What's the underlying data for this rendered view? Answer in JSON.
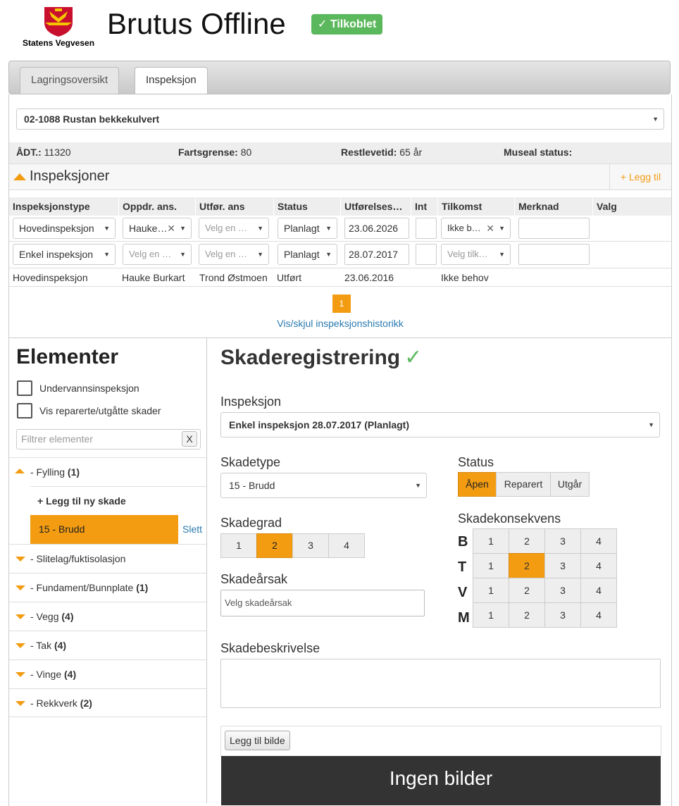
{
  "brand": {
    "logo_text": "Statens Vegvesen",
    "title": "Brutus Offline",
    "status_badge": "✓ Tilkoblet",
    "accent": "#f39c12",
    "success": "#5cb85c"
  },
  "tabs": [
    {
      "label": "Lagringsoversikt"
    },
    {
      "label": "Inspeksjon"
    }
  ],
  "structure_select": "02-1088 Rustan bekkekulvert",
  "info": {
    "adt_label": "ÅDT.:",
    "adt_value": "11320",
    "fart_label": "Fartsgrense:",
    "fart_value": "80",
    "rest_label": "Restlevetid:",
    "rest_value": "65 år",
    "museal_label": "Museal status:"
  },
  "inspeksjoner": {
    "title": "Inspeksjoner",
    "add_label": "+ Legg til",
    "columns": [
      "Inspeksjonstype",
      "Oppdr. ans.",
      "Utfør. ans",
      "Status",
      "Utførelses…",
      "Int",
      "Tilkomst",
      "Merknad",
      "Valg"
    ],
    "rows": [
      {
        "type": "Hovedinspeksjon",
        "oppdr": "Hauke…",
        "utfor": "Velg en …",
        "status": "Planlagt",
        "date": "23.06.2026",
        "tilkomst": "Ikke b…"
      },
      {
        "type": "Enkel inspeksjon",
        "oppdr": "Velg en …",
        "utfor": "Velg en …",
        "status": "Planlagt",
        "date": "28.07.2017",
        "tilkomst": "Velg tilk…"
      },
      {
        "type": "Hovedinspeksjon",
        "oppdr": "Hauke Burkart",
        "utfor": "Trond Østmoen",
        "status": "Utført",
        "date": "23.06.2016",
        "tilkomst": "Ikke behov"
      }
    ],
    "page": "1",
    "history_link": "Vis/skjul inspeksjonshistorikk"
  },
  "elementer": {
    "title": "Elementer",
    "cb1": "Undervannsinspeksjon",
    "cb2": "Vis reparerte/utgåtte skader",
    "filter_placeholder": "Filtrer elementer",
    "filter_clear": "X",
    "items": [
      {
        "name": "- Fylling",
        "count": "(1)"
      },
      {
        "name": "- Slitelag/fuktisolasjon",
        "count": ""
      },
      {
        "name": "- Fundament/Bunnplate",
        "count": "(1)"
      },
      {
        "name": "- Vegg",
        "count": "(4)"
      },
      {
        "name": "- Tak",
        "count": "(4)"
      },
      {
        "name": "- Vinge",
        "count": "(4)"
      },
      {
        "name": "- Rekkverk",
        "count": "(2)"
      }
    ],
    "add_skade": "+ Legg til ny skade",
    "skade": "15 - Brudd",
    "slett": "Slett"
  },
  "skade": {
    "title": "Skaderegistrering",
    "check": "✓",
    "insp_label": "Inspeksjon",
    "insp_value": "Enkel inspeksjon 28.07.2017 (Planlagt)",
    "type_label": "Skadetype",
    "type_value": "15 - Brudd",
    "status_label": "Status",
    "status_opts": [
      "Åpen",
      "Reparert",
      "Utgår"
    ],
    "grad_label": "Skadegrad",
    "grad_opts": [
      "1",
      "2",
      "3",
      "4"
    ],
    "kons_label": "Skadekonsekvens",
    "kons_rows": [
      "B",
      "T",
      "V",
      "M"
    ],
    "kons_opts": [
      "1",
      "2",
      "3",
      "4"
    ],
    "arsak_label": "Skadeårsak",
    "arsak_placeholder": "Velg skadeårsak",
    "beskr_label": "Skadebeskrivelse",
    "bilde_btn": "Legg til bilde",
    "ingen": "Ingen bilder"
  }
}
